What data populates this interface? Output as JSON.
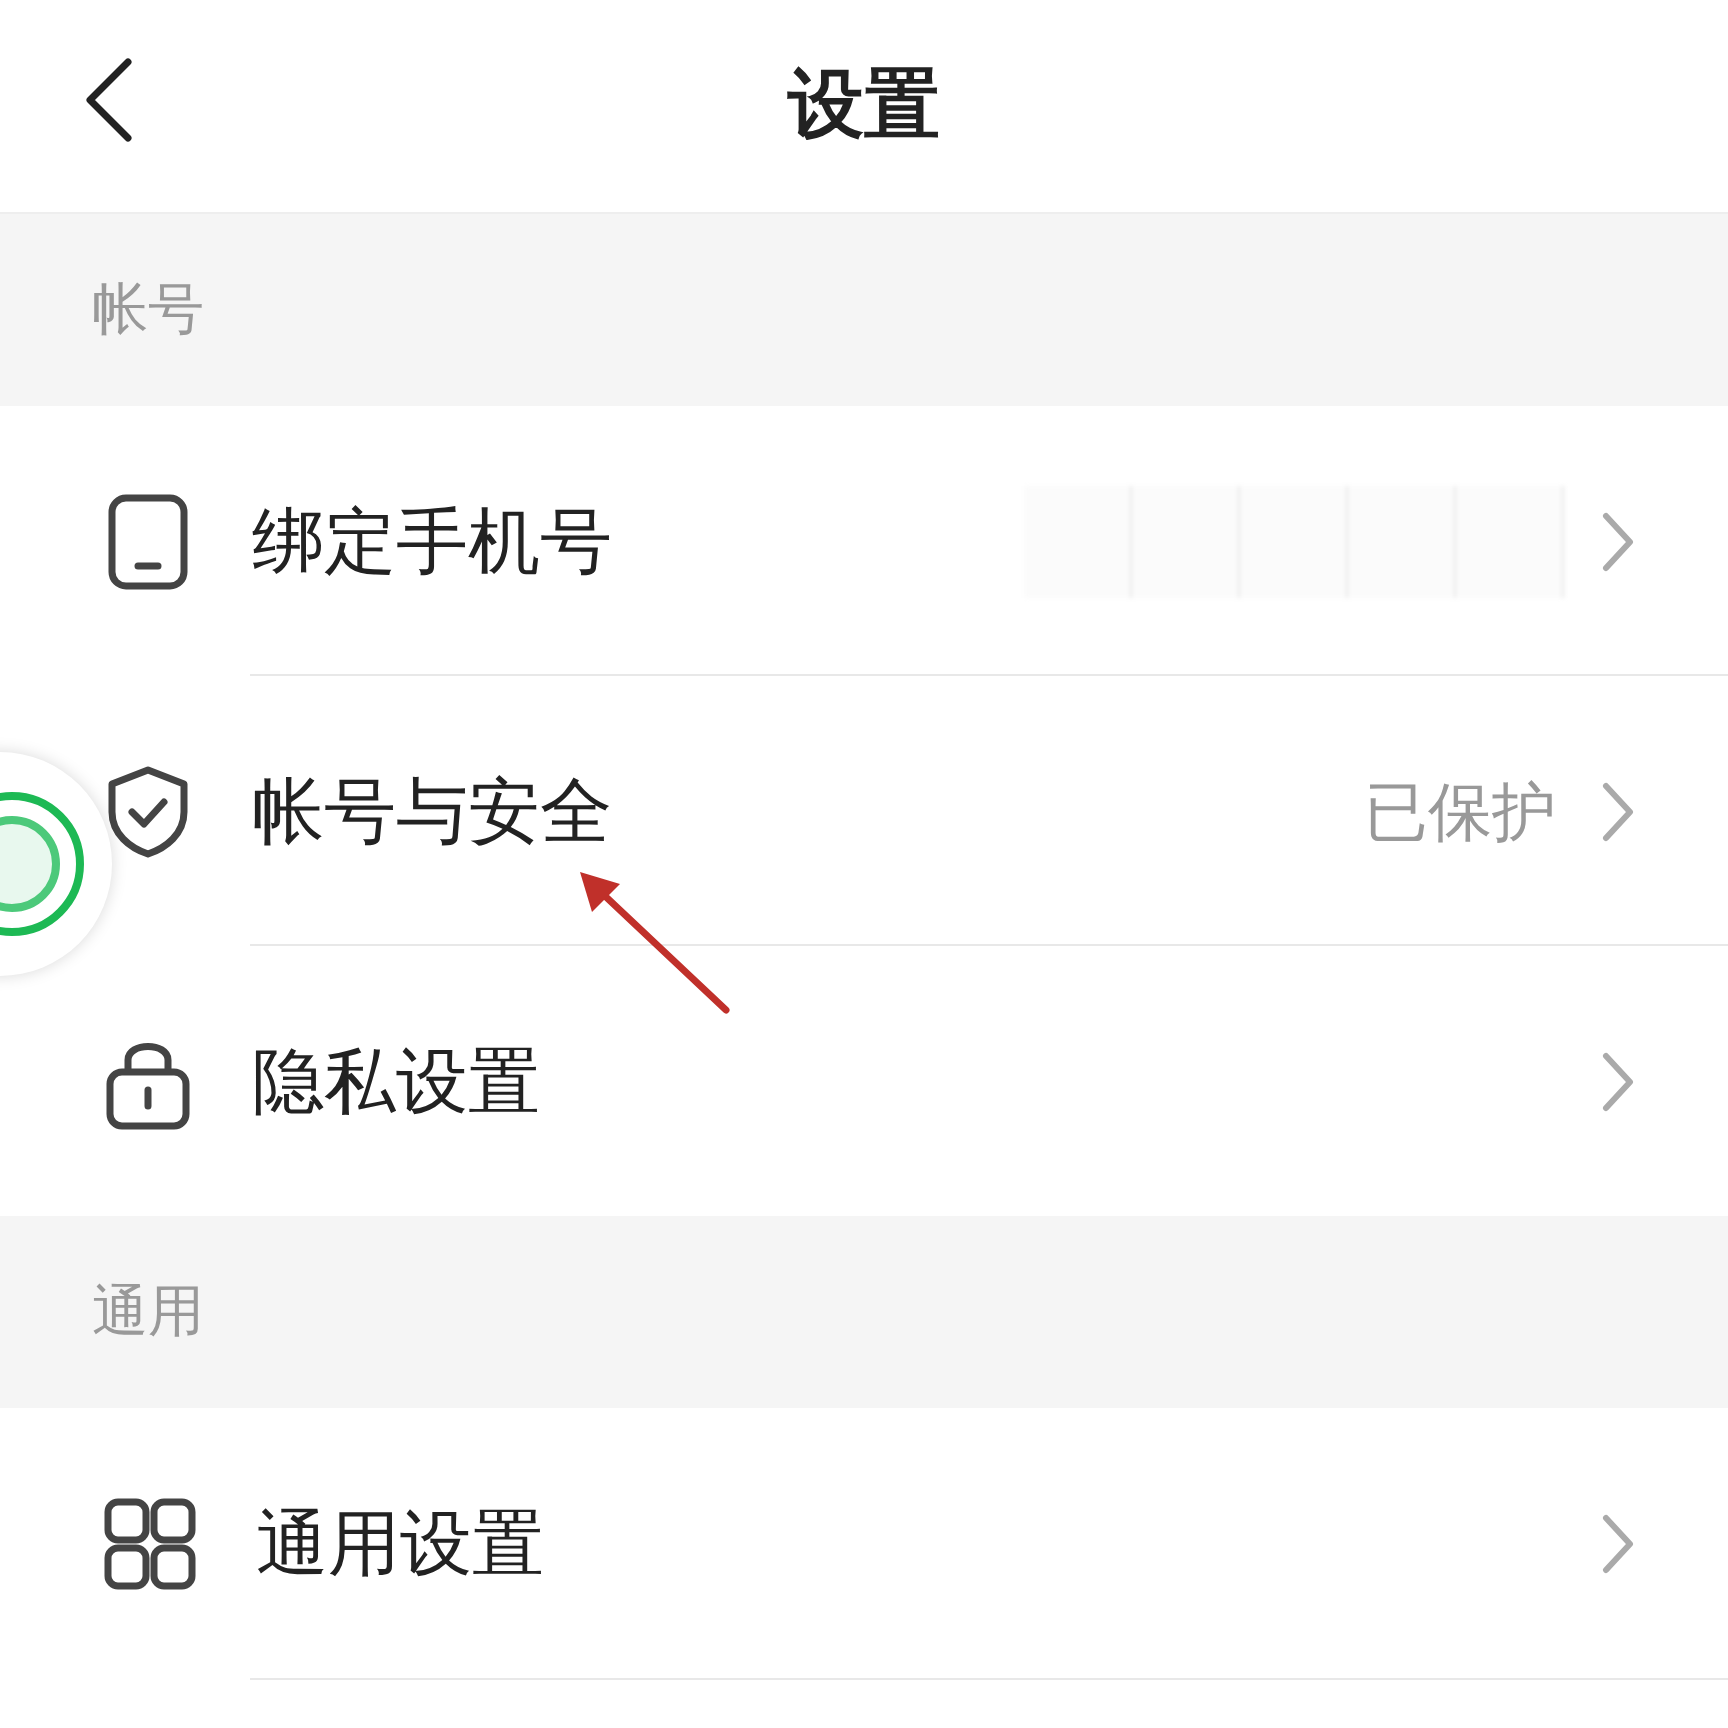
{
  "header": {
    "title": "设置"
  },
  "sections": [
    {
      "title": "帐号",
      "items": [
        {
          "kind": "phone",
          "label": "绑定手机号",
          "value_obscured": true
        },
        {
          "kind": "shield",
          "label": "帐号与安全",
          "value": "已保护"
        },
        {
          "kind": "lock",
          "label": "隐私设置"
        }
      ]
    },
    {
      "title": "通用",
      "items": [
        {
          "kind": "grid",
          "label": "通用设置"
        }
      ]
    }
  ]
}
